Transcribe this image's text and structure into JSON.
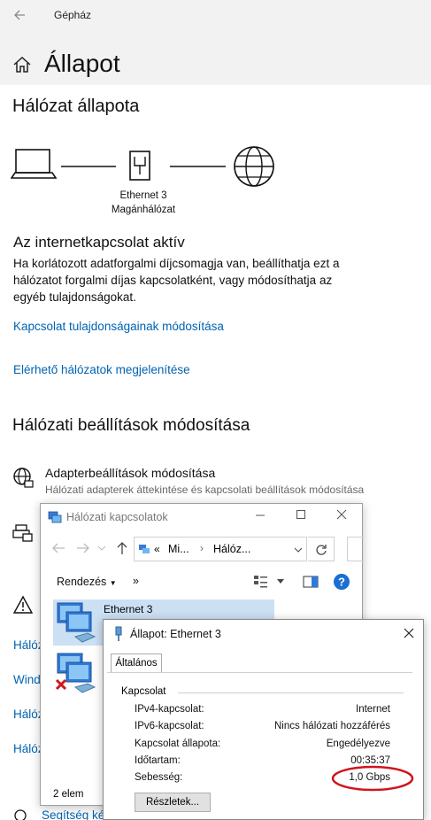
{
  "settings": {
    "app_title": "Gépház",
    "page_title": "Állapot",
    "network_status_heading": "Hálózat állapota",
    "adapter_name": "Ethernet 3",
    "network_type": "Magánhálózat",
    "connected_heading": "Az internetkapcsolat aktív",
    "description": "Ha korlátozott adatforgalmi díjcsomagja van, beállíthatja ezt a hálózatot forgalmi díjas kapcsolatként, vagy módosíthatja az egyéb tulajdonságokat.",
    "link_properties": "Kapcsolat tulajdonságainak módosítása",
    "link_available_networks": "Elérhető hálózatok megjelenítése",
    "change_settings_heading": "Hálózati beállítások módosítása",
    "adapter_options_title": "Adapterbeállítások módosítása",
    "adapter_options_desc": "Hálózati adapterek áttekintése és kapcsolati beállítások módosítása",
    "truncated_links": [
      "Hálóz",
      "Wind",
      "Hálóz",
      "Hálóz"
    ],
    "help_link": "Segítség ké"
  },
  "explorer": {
    "title": "Hálózati kapcsolatok",
    "address_prefix": "«",
    "address_parts": [
      "Mi...",
      "Hálóz..."
    ],
    "organize_label": "Rendezés",
    "more_label": "»",
    "items": [
      {
        "name": "Ethernet 3",
        "status": "connected"
      },
      {
        "name": "",
        "status": "disconnected"
      }
    ],
    "item_count": "2 elem"
  },
  "dialog": {
    "title": "Állapot: Ethernet 3",
    "tab_general": "Általános",
    "group_connection": "Kapcsolat",
    "rows": [
      {
        "label": "IPv4-kapcsolat:",
        "value": "Internet"
      },
      {
        "label": "IPv6-kapcsolat:",
        "value": "Nincs hálózati hozzáférés"
      },
      {
        "label": "Kapcsolat állapota:",
        "value": "Engedélyezve"
      },
      {
        "label": "Időtartam:",
        "value": "00:35:37"
      },
      {
        "label": "Sebesség:",
        "value": "1,0 Gbps"
      }
    ],
    "details_button": "Részletek..."
  },
  "colors": {
    "link": "#0063b1",
    "highlight_ellipse": "#d0141e",
    "selection": "#cce0f4"
  }
}
